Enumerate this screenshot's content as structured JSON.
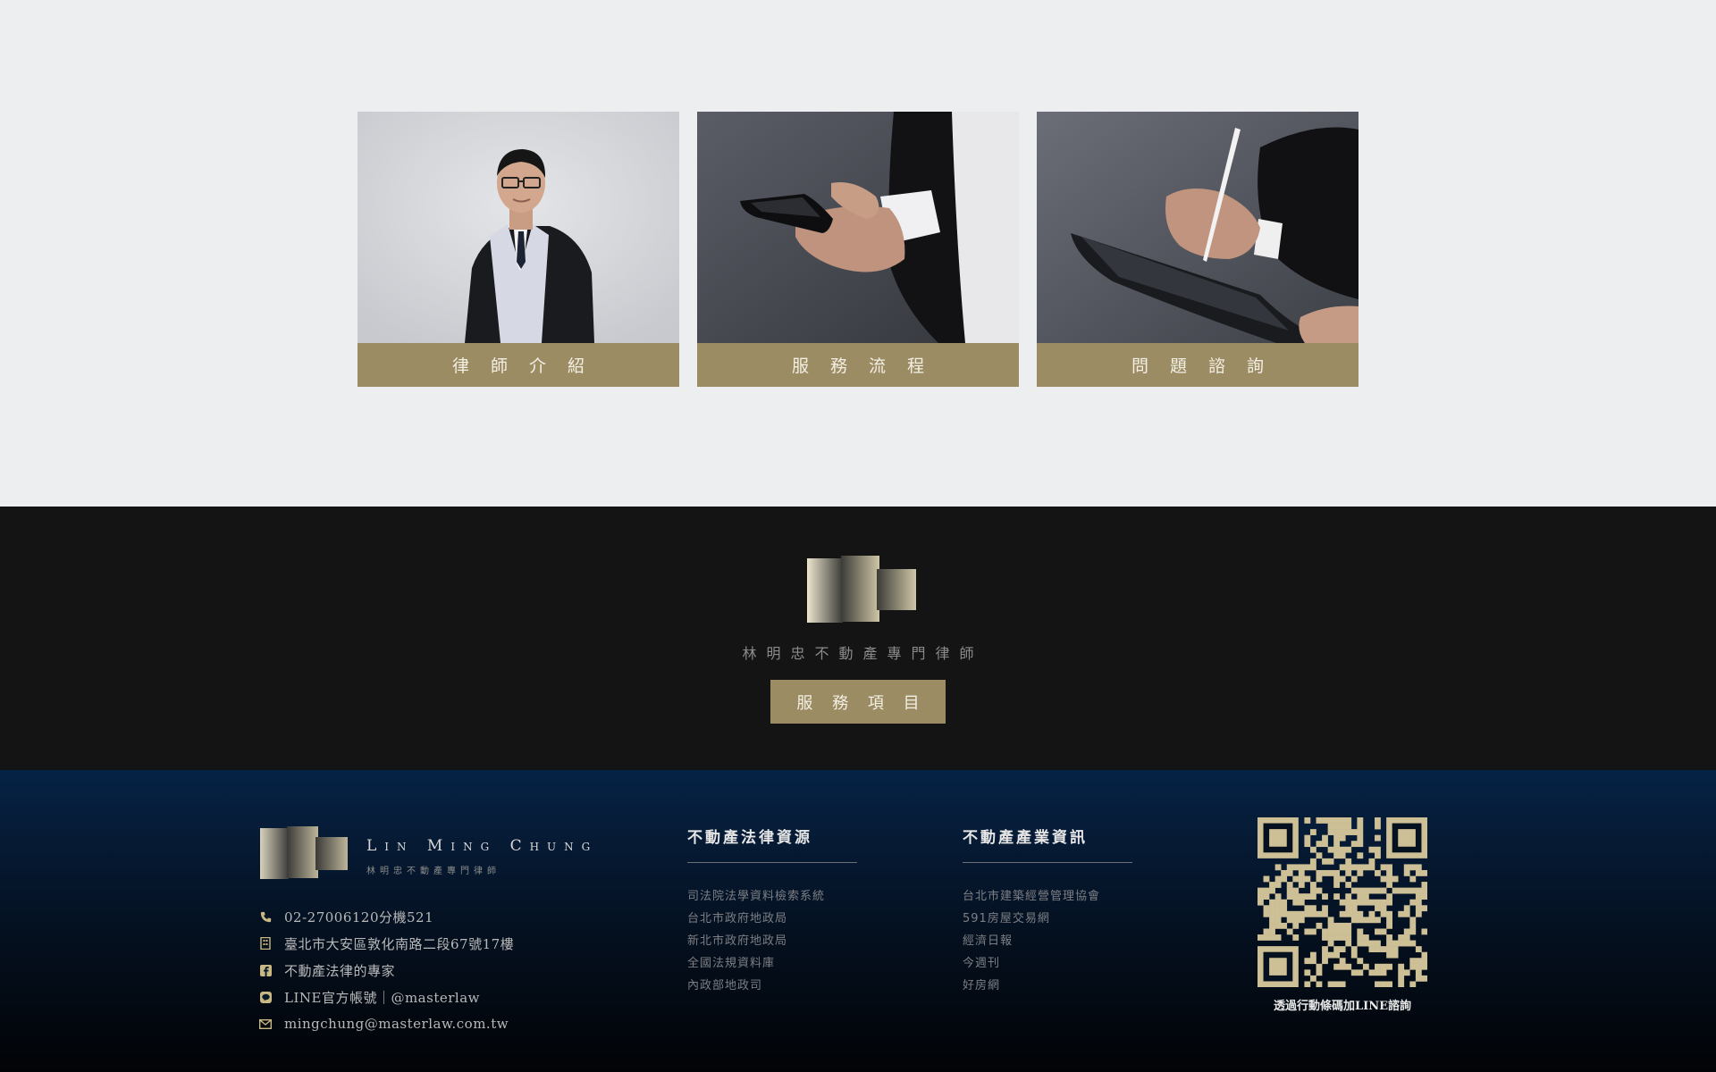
{
  "cards": [
    {
      "label": "律 師 介 紹"
    },
    {
      "label": "服 務 流 程"
    },
    {
      "label": "問 題 諮 詢"
    }
  ],
  "band": {
    "title": "林明忠不動產專門律師",
    "button_label": "服 務 項 目"
  },
  "footer": {
    "brand_en": "Lin Ming Chung",
    "brand_zh": "林明忠不動產專門律師",
    "contacts": [
      {
        "icon": "phone-icon",
        "text": "02-27006120分機521"
      },
      {
        "icon": "building-icon",
        "text": "臺北市大安區敦化南路二段67號17樓"
      },
      {
        "icon": "facebook-icon",
        "text": "不動產法律的專家"
      },
      {
        "icon": "line-icon",
        "text": "LINE官方帳號｜@masterlaw"
      },
      {
        "icon": "mail-icon",
        "text": "mingchung@masterlaw.com.tw"
      }
    ],
    "legal_resources": {
      "heading": "不動產法律資源",
      "links": [
        "司法院法學資料檢索系統",
        "台北市政府地政局",
        "新北市政府地政局",
        "全國法規資料庫",
        "內政部地政司"
      ]
    },
    "industry_info": {
      "heading": "不動產產業資訊",
      "links": [
        "台北市建築經營管理協會",
        "591房屋交易網",
        "經濟日報",
        "今週刊",
        "好房網"
      ]
    },
    "qr_caption": "透過行動條碼加LINE諮詢"
  },
  "colors": {
    "gold": "#9b8c64",
    "page_bg": "#edeef0",
    "band_bg": "#141414",
    "footer_top": "#052346",
    "footer_bottom": "#020306",
    "qr_gold": "#cdbf96"
  }
}
